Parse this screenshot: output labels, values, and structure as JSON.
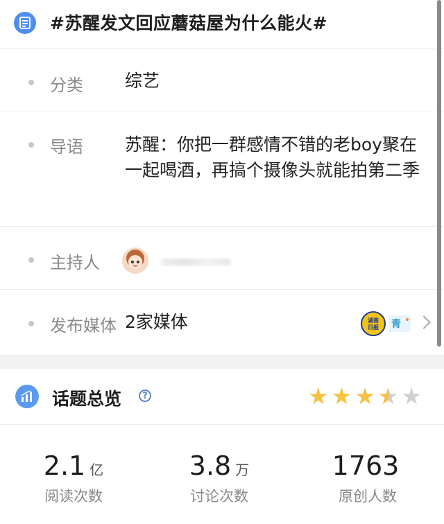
{
  "topic": {
    "title": "#苏醒发文回应蘑菇屋为什么能火#",
    "icon": "list-icon"
  },
  "info_rows": [
    {
      "label": "分类",
      "value": "综艺"
    },
    {
      "label": "导语",
      "value": "苏醒：你把一群感情不错的老boy聚在一起喝酒，再搞个摄像头就能拍第二季"
    },
    {
      "label": "主持人",
      "value": ""
    },
    {
      "label": "发布媒体",
      "value": "2家媒体"
    }
  ],
  "media_logos": [
    {
      "name": "media-logo-yellow-icon",
      "text": "湖南日报"
    },
    {
      "name": "media-logo-qingchun-icon",
      "text": "青"
    }
  ],
  "overview": {
    "title": "话题总览",
    "rating": 3.5,
    "rating_max": 5,
    "colors": {
      "star": "#f5c242",
      "star_empty": "#d0d0d0",
      "accent": "#5a9bf0"
    }
  },
  "stats": [
    {
      "value": "2.1",
      "unit": "亿",
      "label": "阅读次数"
    },
    {
      "value": "3.8",
      "unit": "万",
      "label": "讨论次数"
    },
    {
      "value": "1763",
      "unit": "",
      "label": "原创人数"
    }
  ]
}
